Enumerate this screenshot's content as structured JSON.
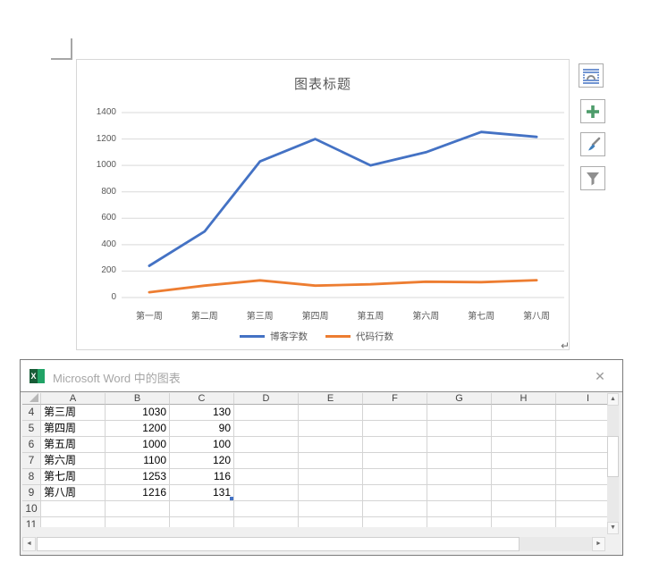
{
  "chart_data": {
    "type": "line",
    "title": "图表标题",
    "categories": [
      "第一周",
      "第二周",
      "第三周",
      "第四周",
      "第五周",
      "第六周",
      "第七周",
      "第八周"
    ],
    "series": [
      {
        "name": "博客字数",
        "color": "#4472C4",
        "values": [
          240,
          500,
          1030,
          1200,
          1000,
          1100,
          1253,
          1216
        ]
      },
      {
        "name": "代码行数",
        "color": "#ED7D31",
        "values": [
          40,
          90,
          130,
          90,
          100,
          120,
          116,
          131
        ]
      }
    ],
    "ylim": [
      0,
      1400
    ],
    "ytick_labels_top_to_bottom": [
      "1400",
      "1200",
      "1000",
      "800",
      "600",
      "400",
      "200",
      "0"
    ],
    "grid": true,
    "gridline_color": "#D9D9D9",
    "axis_text_color": "#595959",
    "legend_position": "bottom"
  },
  "chart_tools": {
    "buttons": [
      {
        "icon": "layout-options-icon"
      },
      {
        "icon": "add-chart-element-icon",
        "accent": "#4E9C6B"
      },
      {
        "icon": "chart-style-brush-icon"
      },
      {
        "icon": "chart-filter-icon"
      }
    ]
  },
  "word": {
    "paragraph_mark": "↵"
  },
  "sheet": {
    "title": "Microsoft Word 中的图表",
    "app_icon": "excel-icon",
    "app_icon_letter": "X",
    "close_icon": "close-icon",
    "close_glyph": "✕",
    "columns": [
      "A",
      "B",
      "C",
      "D",
      "E",
      "F",
      "G",
      "H",
      "I"
    ],
    "rows": [
      {
        "num": "4",
        "a": "第三周",
        "b": "1030",
        "c": "130"
      },
      {
        "num": "5",
        "a": "第四周",
        "b": "1200",
        "c": "90"
      },
      {
        "num": "6",
        "a": "第五周",
        "b": "1000",
        "c": "100"
      },
      {
        "num": "7",
        "a": "第六周",
        "b": "1100",
        "c": "120"
      },
      {
        "num": "8",
        "a": "第七周",
        "b": "1253",
        "c": "116"
      },
      {
        "num": "9",
        "a": "第八周",
        "b": "1216",
        "c": "131"
      },
      {
        "num": "10",
        "a": "",
        "b": "",
        "c": ""
      },
      {
        "num": "11",
        "a": "",
        "b": "",
        "c": ""
      }
    ],
    "scroll": {
      "up": "▲",
      "down": "▼",
      "left": "◄",
      "right": "►"
    }
  }
}
